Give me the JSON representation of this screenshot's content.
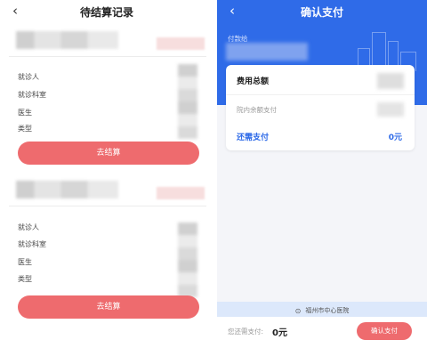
{
  "left": {
    "back_icon": "‹",
    "title": "待结算记录",
    "cards": [
      {
        "fields": [
          "就诊人",
          "就诊科室",
          "医生",
          "类型"
        ],
        "button": "去结算"
      },
      {
        "fields": [
          "就诊人",
          "就诊科室",
          "医生",
          "类型"
        ],
        "button": "去结算"
      }
    ]
  },
  "right": {
    "back_icon": "‹",
    "title": "确认支付",
    "payee_label": "付款给",
    "total_label": "费用总额",
    "balance_label": "院内余额支付",
    "need_label": "还需支付",
    "need_value": "0元",
    "hospital_pin": "⊙",
    "hospital_name": "福州市中心医院",
    "bottom_label": "您还需支付:",
    "bottom_value": "0元",
    "confirm_button": "确认支付"
  },
  "colors": {
    "primary_blue": "#2f6be8",
    "button_red": "#ee6b6e",
    "hospital_bar": "#dce8fb"
  }
}
